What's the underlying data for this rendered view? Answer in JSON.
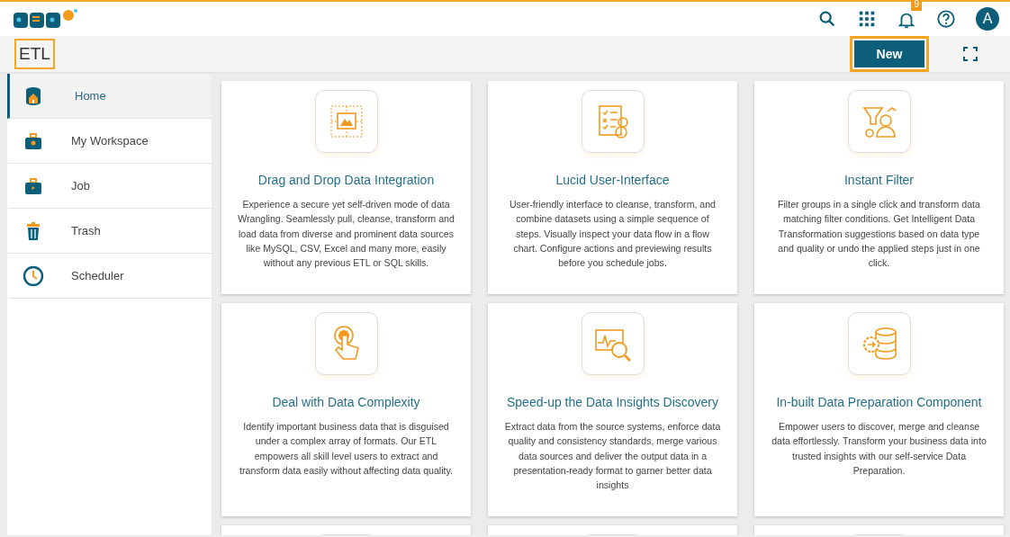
{
  "header": {
    "notification_count": "9",
    "avatar_letter": "A"
  },
  "toolbar": {
    "title": "ETL",
    "title_highlighted": true,
    "new_button": "New",
    "new_button_highlighted": true
  },
  "sidebar": {
    "items": [
      {
        "label": "Home",
        "selected": true
      },
      {
        "label": "My Workspace",
        "selected": false
      },
      {
        "label": "Job",
        "selected": false
      },
      {
        "label": "Trash",
        "selected": false
      },
      {
        "label": "Scheduler",
        "selected": false
      }
    ]
  },
  "cards": [
    {
      "kind": "feature",
      "title": "Drag and Drop Data Integration",
      "text": "Experience a secure yet self-driven mode of data Wrangling. Seamlessly pull, cleanse, transform and load data from diverse and prominent data sources like MySQL, CSV, Excel and many more, easily without any previous ETL or SQL skills."
    },
    {
      "kind": "feature",
      "title": "Lucid User-Interface",
      "text": "User-friendly interface to cleanse, transform, and combine datasets using a simple sequence of steps. Visually inspect your data flow in a flow chart. Configure actions and previewing results before you schedule jobs."
    },
    {
      "kind": "feature",
      "title": "Instant Filter",
      "text": "Filter groups in a single click and transform data matching filter conditions. Get Intelligent Data Transformation suggestions based on data type and quality or undo the applied steps just in one click."
    },
    {
      "kind": "feature",
      "title": "Deal with Data Complexity",
      "text": "Identify important business data that is disguised under a complex array of formats. Our ETL empowers all skill level users to extract and transform data easily without affecting data quality."
    },
    {
      "kind": "feature",
      "title": "Speed-up the Data Insights Discovery",
      "text": "Extract data from the source systems, enforce data quality and consistency standards, merge various data sources and deliver the output data in a presentation-ready format to garner better data insights"
    },
    {
      "kind": "feature",
      "title": "In-built Data Preparation Component",
      "text": "Empower users to discover, merge and cleanse data effortlessly. Transform your business data into trusted insights with our self-service Data Preparation."
    },
    {
      "kind": "partial"
    },
    {
      "kind": "partial"
    },
    {
      "kind": "partial"
    }
  ]
}
